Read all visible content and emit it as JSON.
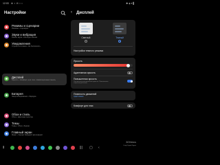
{
  "status": {
    "time": "12:03",
    "left_icons": "⊕ ▪ ✉ ▪ •",
    "right_icons": "✱ ◈ ▾ ▌"
  },
  "left": {
    "title": "Настройки",
    "items": [
      {
        "label": "Режимы и сценарии",
        "sub": "Режимы • Сценарии",
        "color": "#e5484d",
        "selected": false
      },
      {
        "label": "Звуки и вибрация",
        "sub": "Режим звука • Мелодия звонка",
        "color": "#8a63d2",
        "selected": false
      },
      {
        "label": "Уведомления",
        "sub": "Строка состояния • Не беспокоить",
        "color": "#e08a2e",
        "selected": false
      },
      {
        "label": "Дисплей",
        "sub": "Яркость • Комфорт для глаз • Навигационная панель",
        "color": "#52b043",
        "selected": true
      },
      {
        "label": "Батарея",
        "sub": "Энергосбережение • Зарядка",
        "color": "#43a047",
        "selected": false
      },
      {
        "label": "Обои и стиль",
        "sub": "Обои • Цветовая палитра",
        "color": "#d94f7a",
        "selected": false
      },
      {
        "label": "Темы",
        "sub": "Темы • Обои • Значки",
        "color": "#8e6ad8",
        "selected": false
      },
      {
        "label": "Главный экран",
        "sub": "Макет • Значки бейджей приложений",
        "color": "#3f7fe0",
        "selected": false
      }
    ]
  },
  "right": {
    "back": "‹",
    "title": "Дисплей",
    "mode_light": "Светлый",
    "mode_dark": "Темный",
    "dark_settings": "Настройки темного режима",
    "brightness": {
      "label": "Яркость",
      "level": 0.93
    },
    "adaptive": {
      "label": "Адаптивная яркость",
      "on": false
    },
    "extra_bright": {
      "label": "Повышенная яркость",
      "sub": "Увеличение максимальной яркости. Повышенное энергопотребление.",
      "on": true
    },
    "motion": {
      "label": "Плавность движений",
      "sub": "Адаптивная"
    },
    "eye_comfort": {
      "label": "Комфорт для глаз",
      "on": false
    }
  },
  "dock": {
    "apps": [
      {
        "name": "phone",
        "color": "#3fb44e"
      },
      {
        "name": "chrome",
        "color": "#e0463b"
      },
      {
        "name": "gallery",
        "color": "#d64f8b"
      },
      {
        "name": "messages",
        "color": "#3d7ddd"
      },
      {
        "name": "telegram",
        "color": "#2ea6df"
      },
      {
        "name": "whatsapp",
        "color": "#40c351"
      },
      {
        "name": "settings",
        "color": "#8a8a8a"
      },
      {
        "name": "store",
        "color": "#6f55d6"
      },
      {
        "name": "camera",
        "color": "#e0404e"
      }
    ]
  },
  "watermark": "3DNews\nDaily Digital Digest"
}
